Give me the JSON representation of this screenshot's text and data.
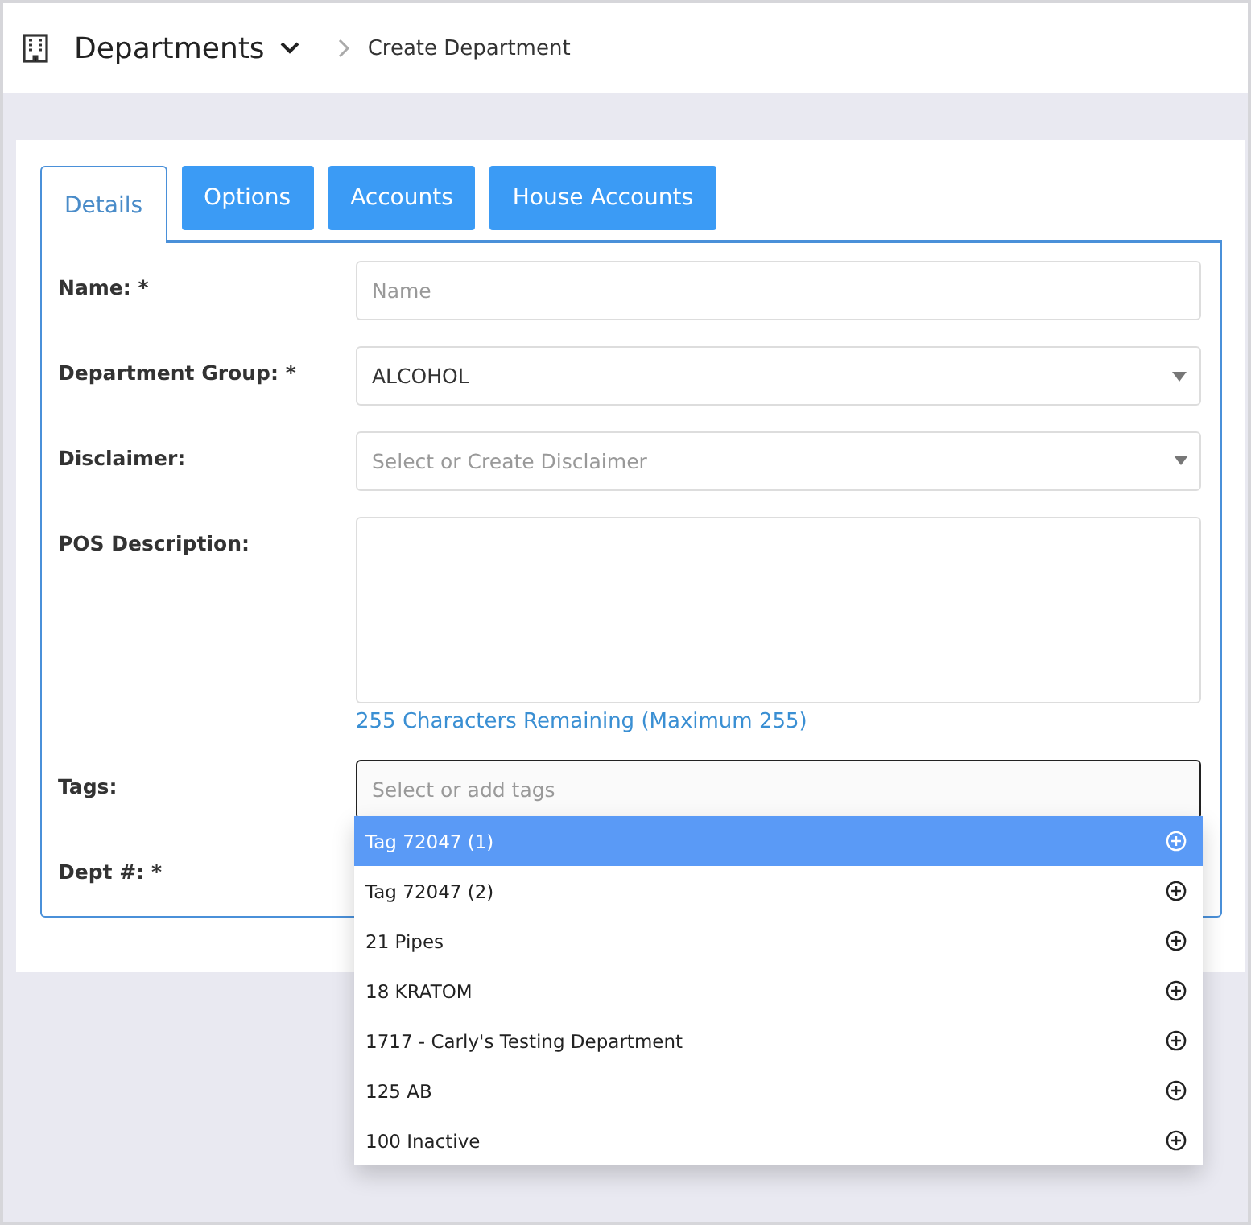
{
  "breadcrumb": {
    "section": "Departments",
    "page": "Create Department"
  },
  "tabs": [
    {
      "label": "Details",
      "selected": true
    },
    {
      "label": "Options",
      "selected": false
    },
    {
      "label": "Accounts",
      "selected": false
    },
    {
      "label": "House Accounts",
      "selected": false
    }
  ],
  "form": {
    "fields": [
      {
        "kind": "input",
        "label": "Name: *",
        "placeholder": "Name"
      },
      {
        "kind": "select",
        "label": "Department Group: *",
        "value": "ALCOHOL"
      },
      {
        "kind": "select",
        "label": "Disclaimer:",
        "placeholder": "Select or Create Disclaimer"
      },
      {
        "kind": "textarea",
        "label": "POS Description:",
        "hint": "255 Characters Remaining (Maximum 255)"
      },
      {
        "kind": "tags",
        "label": "Tags:",
        "placeholder": "Select or add tags",
        "options": [
          {
            "label": "Tag 72047 (1)",
            "selected": true
          },
          {
            "label": "Tag 72047 (2)",
            "selected": false
          },
          {
            "label": "21 Pipes",
            "selected": false
          },
          {
            "label": "18 KRATOM",
            "selected": false
          },
          {
            "label": "1717 - Carly's Testing Department",
            "selected": false
          },
          {
            "label": "125 AB",
            "selected": false
          },
          {
            "label": "100 Inactive",
            "selected": false
          }
        ]
      },
      {
        "kind": "hidden",
        "label": "Dept #: *"
      }
    ]
  }
}
